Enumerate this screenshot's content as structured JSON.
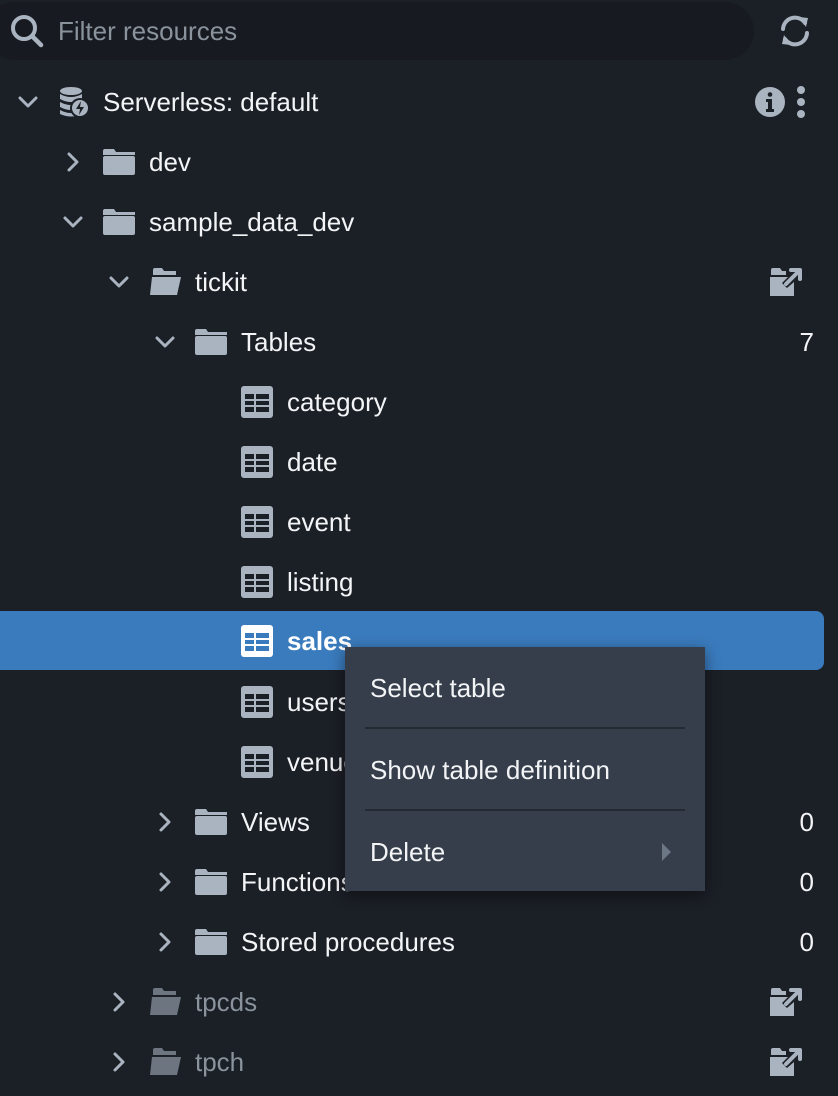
{
  "filter": {
    "placeholder": "Filter resources",
    "value": "",
    "search_icon": "search-icon",
    "refresh_icon": "refresh-icon"
  },
  "colors": {
    "background": "#1b1f26",
    "selected_row": "#3a7bbd",
    "menu_background": "#353e4a",
    "icon_gray": "#aab4c0",
    "muted_text": "#8a929c"
  },
  "tree": {
    "connection": {
      "label": "Serverless: default",
      "expanded": true,
      "icon": "serverless-database-icon",
      "actions": [
        "info-icon",
        "more-options-icon"
      ]
    },
    "databases": [
      {
        "label": "dev",
        "expanded": false,
        "icon": "folder-icon"
      },
      {
        "label": "sample_data_dev",
        "expanded": true,
        "icon": "folder-icon"
      }
    ],
    "schema": {
      "label": "tickit",
      "expanded": true,
      "icon": "open-folder-icon",
      "action": "external-folder-icon"
    },
    "tables_folder": {
      "label": "Tables",
      "expanded": true,
      "count": "7"
    },
    "tables": [
      {
        "label": "category",
        "selected": false
      },
      {
        "label": "date",
        "selected": false
      },
      {
        "label": "event",
        "selected": false
      },
      {
        "label": "listing",
        "selected": false
      },
      {
        "label": "sales",
        "selected": true
      },
      {
        "label": "users",
        "selected": false
      },
      {
        "label": "venue",
        "selected": false
      }
    ],
    "other_folders": [
      {
        "label": "Views",
        "expanded": false,
        "count": "0"
      },
      {
        "label": "Functions",
        "expanded": false,
        "count": "0"
      },
      {
        "label": "Stored procedures",
        "expanded": false,
        "count": "0"
      }
    ],
    "external_schemas": [
      {
        "label": "tpcds",
        "expanded": false,
        "action": "external-folder-icon"
      },
      {
        "label": "tpch",
        "expanded": false,
        "action": "external-folder-icon"
      }
    ]
  },
  "context_menu": {
    "items": [
      {
        "label": "Select table",
        "has_submenu": false
      },
      {
        "label": "Show table definition",
        "has_submenu": false
      },
      {
        "label": "Delete",
        "has_submenu": true
      }
    ]
  }
}
